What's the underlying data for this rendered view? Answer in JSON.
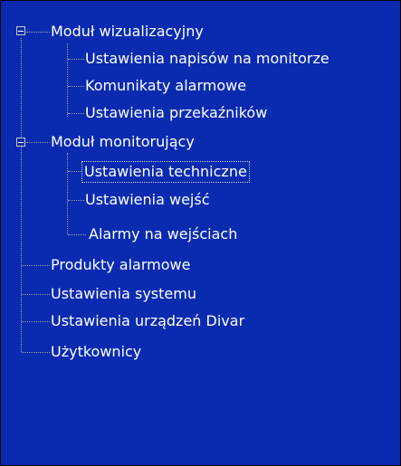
{
  "tree": {
    "groups": [
      {
        "label": "Moduł wizualizacyjny",
        "expanded": true,
        "children": [
          "Ustawienia napisów na monitorze",
          "Komunikaty alarmowe",
          "Ustawienia przekaźników"
        ]
      },
      {
        "label": "Moduł monitorujący",
        "expanded": true,
        "children": [
          "Ustawienia techniczne",
          "Ustawienia wejść",
          "Alarmy na wejściach"
        ]
      }
    ],
    "items": [
      "Produkty alarmowe",
      "Ustawienia systemu",
      "Ustawienia urządzeń Divar",
      "Użytkownicy"
    ],
    "selected": "Ustawienia techniczne"
  },
  "colors": {
    "background": "#0a2bb0",
    "text": "#ffffff",
    "connector": "#a0a0a0"
  }
}
